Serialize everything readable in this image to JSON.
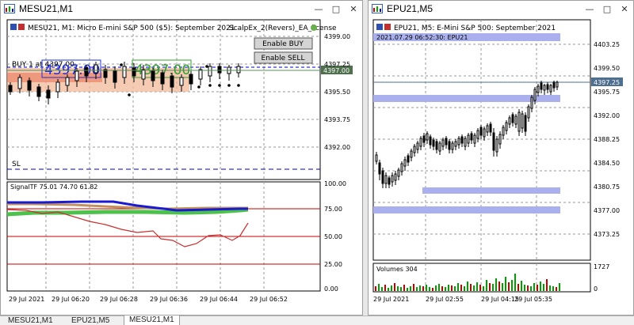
{
  "left": {
    "title": "MESU21,M1",
    "header": "MESU21, M1:  Micro E-mini S&P 500 ($5): September 2021",
    "ea_name": "ScalpEx_2(Revers)_EA_license",
    "enable_buy": "Enable BUY",
    "enable_sell": "Enable SELL",
    "buy_line": "BUY 1 at 4397.00",
    "big_price_1": "4397.00",
    "big_price_2": "4397.00",
    "sl_label": "SL",
    "price_tag": "4397.00",
    "price_ticks": [
      "4399.00",
      "4397.25",
      "4395.50",
      "4393.75",
      "4392.00"
    ],
    "indicator_label": "SignalTF 75.01 74.70 61.82",
    "ind_ticks": [
      "100.00",
      "75.00",
      "50.00",
      "25.00",
      "0.00"
    ],
    "time_ticks": [
      "29 Jul 2021",
      "29 Jul 06:20",
      "29 Jul 06:28",
      "29 Jul 06:36",
      "29 Jul 06:44",
      "29 Jul 06:52"
    ]
  },
  "right": {
    "title": "EPU21,M5",
    "header": "EPU21, M5:  E-Mini S&P 500: September 2021",
    "sub_header": "2021.07.29 06:52:30: EPU21",
    "price_tag": "4397.25",
    "price_ticks": [
      "4403.25",
      "4399.50",
      "4395.75",
      "4392.00",
      "4388.25",
      "4384.50",
      "4380.75",
      "4377.00",
      "4373.25"
    ],
    "volumes_label": "Volumes 304",
    "vol_ticks": [
      "1727",
      "0"
    ],
    "time_ticks": [
      "29 Jul 2021",
      "29 Jul 02:55",
      "29 Jul 04:15",
      "29 Jul 05:35"
    ]
  },
  "tabs": [
    "MESU21,M1",
    "EPU21,M5",
    "MESU21,M1"
  ],
  "colors": {
    "accent_blue": "#0000c8",
    "band": "#aab0ee",
    "red": "#c80000",
    "green_vol": "#00a000"
  }
}
